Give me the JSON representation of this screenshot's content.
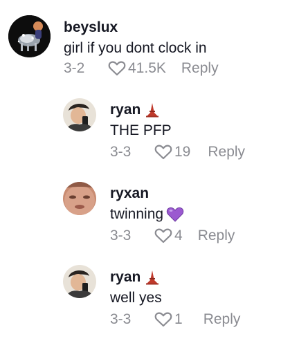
{
  "comments": [
    {
      "username": "beyslux",
      "text": "girl if you dont clock in",
      "date": "3-2",
      "likes": "41.5K",
      "reply_label": "Reply",
      "avatar_icon": "sparkly-figure-avatar"
    },
    {
      "username": "ryan",
      "badge_icon": "tower-emoji",
      "text": "THE PFP",
      "date": "3-3",
      "likes": "19",
      "reply_label": "Reply",
      "avatar_icon": "person-selfie-avatar"
    },
    {
      "username": "ryxan",
      "text": "twinning",
      "text_emoji_icon": "purple-heart-emoji",
      "date": "3-3",
      "likes": "4",
      "reply_label": "Reply",
      "avatar_icon": "face-closeup-avatar"
    },
    {
      "username": "ryan",
      "badge_icon": "tower-emoji",
      "text": "well yes",
      "date": "3-3",
      "likes": "1",
      "reply_label": "Reply",
      "avatar_icon": "person-selfie-avatar"
    }
  ],
  "colors": {
    "text": "#161823",
    "meta": "#8a8b91",
    "heart_emoji": "#9b59d0",
    "tower_emoji": "#c0392b"
  }
}
